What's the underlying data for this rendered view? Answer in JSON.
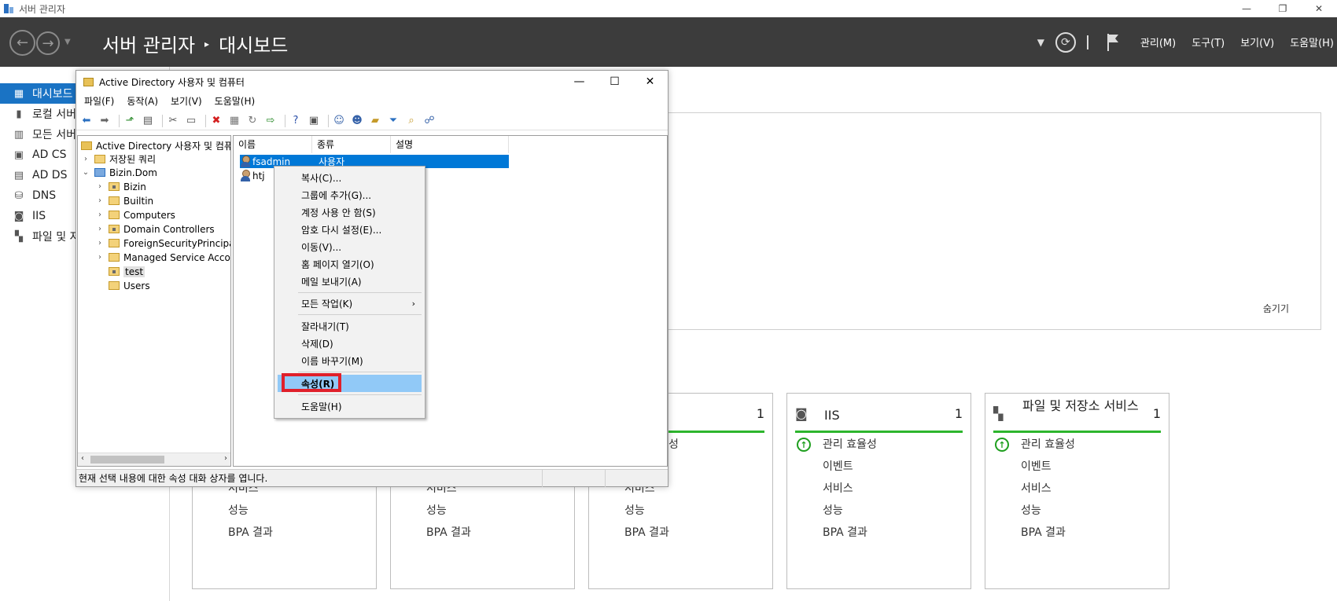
{
  "titlebar": {
    "title": "서버 관리자",
    "min": "—",
    "restore": "❐",
    "close": "✕"
  },
  "header": {
    "crumb_root": "서버 관리자",
    "crumb_sep": "▸",
    "crumb_page": "대시보드",
    "menus": [
      "관리(M)",
      "도구(T)",
      "보기(V)",
      "도움말(H)"
    ]
  },
  "sidebar": {
    "items": [
      {
        "label": "대시보드",
        "icon": "dashboard-icon"
      },
      {
        "label": "로컬 서버",
        "icon": "server-icon"
      },
      {
        "label": "모든 서버",
        "icon": "servers-icon"
      },
      {
        "label": "AD CS",
        "icon": "certificate-icon"
      },
      {
        "label": "AD DS",
        "icon": "directory-icon"
      },
      {
        "label": "DNS",
        "icon": "dns-icon"
      },
      {
        "label": "IIS",
        "icon": "iis-icon"
      },
      {
        "label": "파일 및 저장소 서비스",
        "icon": "storage-icon"
      }
    ]
  },
  "welcome": {
    "hide": "숨기기"
  },
  "tiles": [
    {
      "name": "",
      "count": "",
      "rows": [
        "",
        "서비스",
        "성능",
        "BPA 결과"
      ]
    },
    {
      "name": "",
      "count": "",
      "rows": [
        "",
        "서비스",
        "성능",
        "BPA 결과"
      ]
    },
    {
      "name": "",
      "count": "1",
      "rows": [
        "관리 효율성",
        "서비스",
        "성능",
        "BPA 결과"
      ]
    },
    {
      "name": "IIS",
      "count": "1",
      "rows": [
        "관리 효율성",
        "이벤트",
        "서비스",
        "성능",
        "BPA 결과"
      ]
    },
    {
      "name": "파일 및 저장소 서비스",
      "count": "1",
      "rows": [
        "관리 효율성",
        "이벤트",
        "서비스",
        "성능",
        "BPA 결과"
      ]
    }
  ],
  "aduc": {
    "title": "Active Directory 사용자 및 컴퓨터",
    "menu": [
      "파일(F)",
      "동작(A)",
      "보기(V)",
      "도움말(H)"
    ],
    "tree": {
      "root": "Active Directory 사용자 및 컴퓨터",
      "saved_queries": "저장된 쿼리",
      "domain": "Bizin.Dom",
      "children": [
        "Bizin",
        "Builtin",
        "Computers",
        "Domain Controllers",
        "ForeignSecurityPrincipal",
        "Managed Service Accou",
        "test",
        "Users"
      ]
    },
    "columns": [
      "이름",
      "종류",
      "설명"
    ],
    "rows": [
      {
        "name": "fsadmin",
        "type": "사용자"
      },
      {
        "name": "htj",
        "type": ""
      }
    ],
    "status": "현재 선택 내용에 대한 속성 대화 상자를 엽니다."
  },
  "context_menu": {
    "items": [
      "복사(C)...",
      "그룹에 추가(G)...",
      "계정 사용 안 함(S)",
      "암호 다시 설정(E)...",
      "이동(V)...",
      "홈 페이지 열기(O)",
      "메일 보내기(A)"
    ],
    "all_tasks": "모든 작업(K)",
    "edit_items": [
      "잘라내기(T)",
      "삭제(D)",
      "이름 바꾸기(M)"
    ],
    "properties": "속성(R)",
    "help": "도움말(H)"
  }
}
